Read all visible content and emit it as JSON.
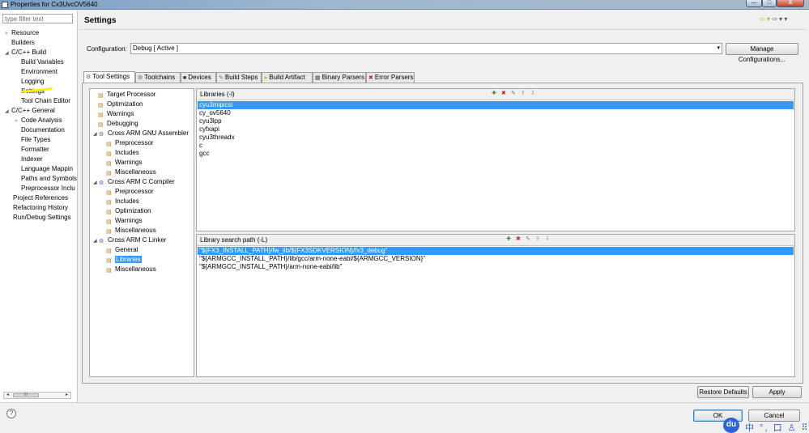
{
  "window": {
    "title": "Properties for Cx3UvcOV5640",
    "min_glyph": "—",
    "max_glyph": "□",
    "close_glyph": "X"
  },
  "left_nav": {
    "filter_placeholder": "type filter text",
    "items": [
      {
        "label": "Resource",
        "expander": ">"
      },
      {
        "label": "Builders",
        "expander": ""
      },
      {
        "label": "C/C++ Build",
        "expander": "◢"
      },
      {
        "label": "Build Variables",
        "expander": ""
      },
      {
        "label": "Environment",
        "expander": ""
      },
      {
        "label": "Logging",
        "expander": ""
      },
      {
        "label": "Settings",
        "expander": ""
      },
      {
        "label": "Tool Chain Editor",
        "expander": ""
      },
      {
        "label": "C/C++ General",
        "expander": "◢"
      },
      {
        "label": "Code Analysis",
        "expander": ">"
      },
      {
        "label": "Documentation",
        "expander": ""
      },
      {
        "label": "File Types",
        "expander": ""
      },
      {
        "label": "Formatter",
        "expander": ""
      },
      {
        "label": "Indexer",
        "expander": ""
      },
      {
        "label": "Language Mappin",
        "expander": ""
      },
      {
        "label": "Paths and Symbols",
        "expander": ""
      },
      {
        "label": "Preprocessor Inclu",
        "expander": ""
      },
      {
        "label": "Project References",
        "expander": ""
      },
      {
        "label": "Refactoring History",
        "expander": ""
      },
      {
        "label": "Run/Debug Settings",
        "expander": ""
      }
    ],
    "scroll_left": "◂",
    "scroll_right": "▸",
    "scroll_thumb": "III"
  },
  "header": {
    "title": "Settings",
    "nav_back": "⇦ ▾",
    "nav_fwd": "⇨ ▾",
    "menu": "▾"
  },
  "configuration": {
    "label": "Configuration:",
    "value": "Debug  [ Active ]",
    "dropdown_glyph": "▾",
    "manage_label": "Manage Configurations..."
  },
  "tabs": [
    {
      "label": "Tool Settings",
      "icon": "⚙"
    },
    {
      "label": "Toolchains",
      "icon": "⚙"
    },
    {
      "label": "Devices",
      "icon": "■"
    },
    {
      "label": "Build Steps",
      "icon": "✎"
    },
    {
      "label": "Build Artifact",
      "icon": "●"
    },
    {
      "label": "Binary Parsers",
      "icon": "▦"
    },
    {
      "label": "Error Parsers",
      "icon": "✖"
    }
  ],
  "tool_tree": {
    "items": [
      {
        "label": "Target Processor",
        "toggle": "",
        "icon": "▤"
      },
      {
        "label": "Optimization",
        "toggle": "",
        "icon": "▤"
      },
      {
        "label": "Warnings",
        "toggle": "",
        "icon": "▤"
      },
      {
        "label": "Debugging",
        "toggle": "",
        "icon": "▤"
      },
      {
        "label": "Cross ARM GNU Assembler",
        "toggle": "◢",
        "icon": "⚙"
      },
      {
        "label": "Preprocessor",
        "toggle": "",
        "icon": "▤"
      },
      {
        "label": "Includes",
        "toggle": "",
        "icon": "▤"
      },
      {
        "label": "Warnings",
        "toggle": "",
        "icon": "▤"
      },
      {
        "label": "Miscellaneous",
        "toggle": "",
        "icon": "▤"
      },
      {
        "label": "Cross ARM C Compiler",
        "toggle": "◢",
        "icon": "⚙"
      },
      {
        "label": "Preprocessor",
        "toggle": "",
        "icon": "▤"
      },
      {
        "label": "Includes",
        "toggle": "",
        "icon": "▤"
      },
      {
        "label": "Optimization",
        "toggle": "",
        "icon": "▤"
      },
      {
        "label": "Warnings",
        "toggle": "",
        "icon": "▤"
      },
      {
        "label": "Miscellaneous",
        "toggle": "",
        "icon": "▤"
      },
      {
        "label": "Cross ARM C Linker",
        "toggle": "◢",
        "icon": "⚙"
      },
      {
        "label": "General",
        "toggle": "",
        "icon": "▤"
      },
      {
        "label": "Libraries",
        "toggle": "",
        "icon": "▤"
      },
      {
        "label": "Miscellaneous",
        "toggle": "",
        "icon": "▤"
      }
    ]
  },
  "libraries": {
    "label": "Libraries (-l)",
    "icons": {
      "add": "✚",
      "delete": "✖",
      "edit": "✎",
      "up": "⇧",
      "down": "⇩"
    },
    "items": [
      "cyu3mipicsi",
      "cy_ov5640",
      "cyu3lpp",
      "cyfxapi",
      "cyu3threadx",
      "c",
      "gcc"
    ]
  },
  "search_paths": {
    "label": "Library search path (-L)",
    "icons": {
      "add": "✚",
      "delete": "✖",
      "edit": "✎",
      "up": "⇧",
      "down": "⇩"
    },
    "items": [
      "\"${FX3_INSTALL_PATH}/fw_lib/${FX3SDKVERSION}/fx3_debug\"",
      "\"${ARMGCC_INSTALL_PATH}/lib/gcc/arm-none-eabi/${ARMGCC_VERSION}\"",
      "\"${ARMGCC_INSTALL_PATH}/arm-none-eabi/lib\""
    ]
  },
  "buttons": {
    "restore": "Restore Defaults",
    "apply": "Apply",
    "ok": "OK",
    "cancel": "Cancel",
    "help": "?"
  },
  "ime": {
    "logo": "du",
    "glyphs": "中 °, 口 ♙ ⠿"
  },
  "colors": {
    "selection": "#3399ff",
    "highlighter": "#ffef00"
  }
}
